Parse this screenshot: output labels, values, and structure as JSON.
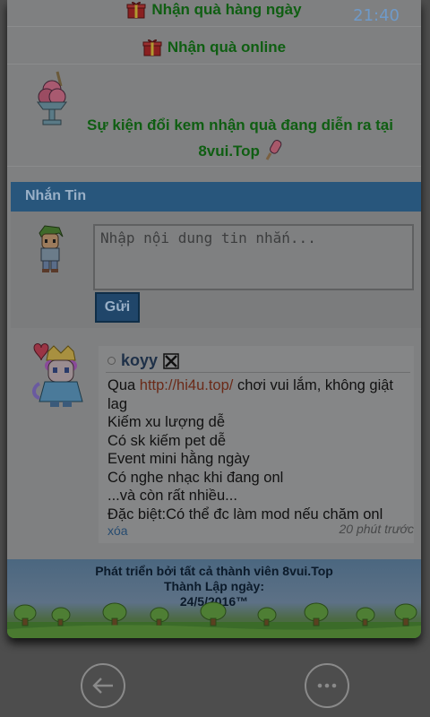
{
  "status": {
    "clock": "21:40"
  },
  "rewards": {
    "daily_label": "Nhận quà hàng ngày",
    "online_label": "Nhận quà online"
  },
  "event": {
    "line1": "Sự kiện đổi kem nhận quà đang diễn ra tại",
    "line2": "8vui.Top"
  },
  "messaging": {
    "header": "Nhắn Tin",
    "input_placeholder": "Nhập nội dung tin nhắn...",
    "send_label": "Gửi"
  },
  "post": {
    "username": "koyy",
    "text_before_link": "Qua ",
    "link": "http://hi4u.top/",
    "text_after_link": " chơi vui lắm, không giật lag",
    "lines": [
      "Kiếm xu lượng dễ",
      "Có sk kiếm pet dễ",
      "Event mini hằng ngày",
      "Có nghe nhạc khi đang onl",
      "...và còn rất nhiều...",
      "Đặc biệt:Có thể đc làm mod nếu chăm onl"
    ],
    "delete_label": "xóa",
    "time": "20 phút trước"
  },
  "footer": {
    "line1": "Phát triển bởi tất cả thành viên 8vui.Top",
    "line2": "Thành Lập ngày:",
    "line3": "24/5/2016™"
  },
  "nav": {
    "back_icon": "arrow-left-icon",
    "more_icon": "more-dots-icon"
  }
}
